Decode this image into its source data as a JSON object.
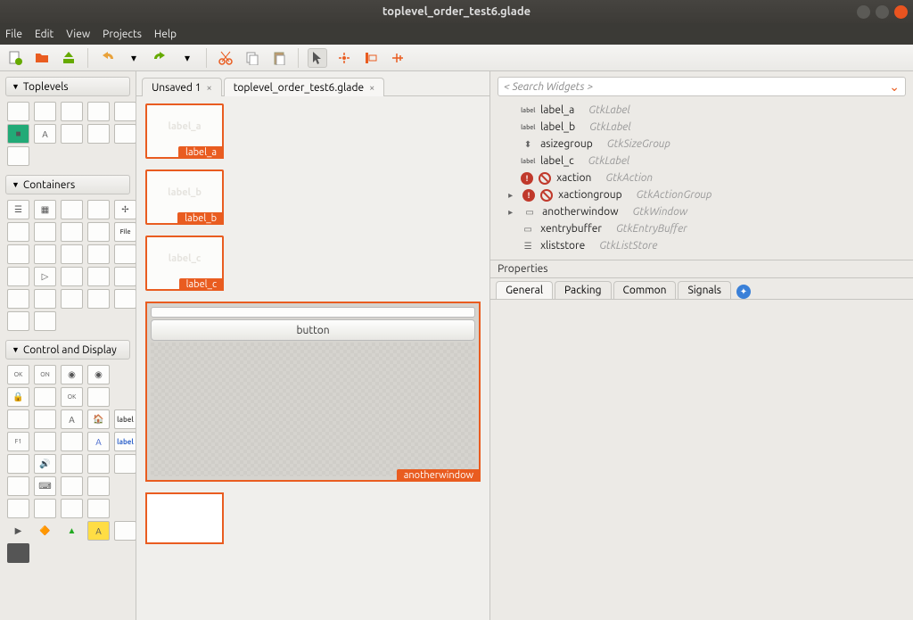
{
  "window": {
    "title": "toplevel_order_test6.glade"
  },
  "menu": {
    "file": "File",
    "edit": "Edit",
    "view": "View",
    "projects": "Projects",
    "help": "Help"
  },
  "palette": {
    "section_toplevels": "Toplevels",
    "section_containers": "Containers",
    "section_control": "Control and Display"
  },
  "tabs": {
    "unsaved": "Unsaved 1",
    "file": "toplevel_order_test6.glade"
  },
  "canvas": {
    "label_a": "label_a",
    "placeholder_a": "label_a",
    "label_b": "label_b",
    "placeholder_b": "label_b",
    "label_c": "label_c",
    "placeholder_c": "label_c",
    "button_text": "button",
    "anotherwindow": "anotherwindow"
  },
  "inspector": {
    "search_placeholder": "< Search Widgets >",
    "items": [
      {
        "icon": "label",
        "name": "label_a",
        "type": "GtkLabel"
      },
      {
        "icon": "label",
        "name": "label_b",
        "type": "GtkLabel"
      },
      {
        "icon": "size",
        "name": "asizegroup",
        "type": "GtkSizeGroup"
      },
      {
        "icon": "label",
        "name": "label_c",
        "type": "GtkLabel"
      },
      {
        "icon": "err",
        "name": "xaction",
        "type": "GtkAction"
      },
      {
        "icon": "err",
        "name": "xactiongroup",
        "type": "GtkActionGroup",
        "expandable": true
      },
      {
        "icon": "win",
        "name": "anotherwindow",
        "type": "GtkWindow",
        "expandable": true
      },
      {
        "icon": "entry",
        "name": "xentrybuffer",
        "type": "GtkEntryBuffer"
      },
      {
        "icon": "list",
        "name": "xliststore",
        "type": "GtkListStore"
      }
    ]
  },
  "properties": {
    "header": "Properties",
    "tab_general": "General",
    "tab_packing": "Packing",
    "tab_common": "Common",
    "tab_signals": "Signals"
  }
}
